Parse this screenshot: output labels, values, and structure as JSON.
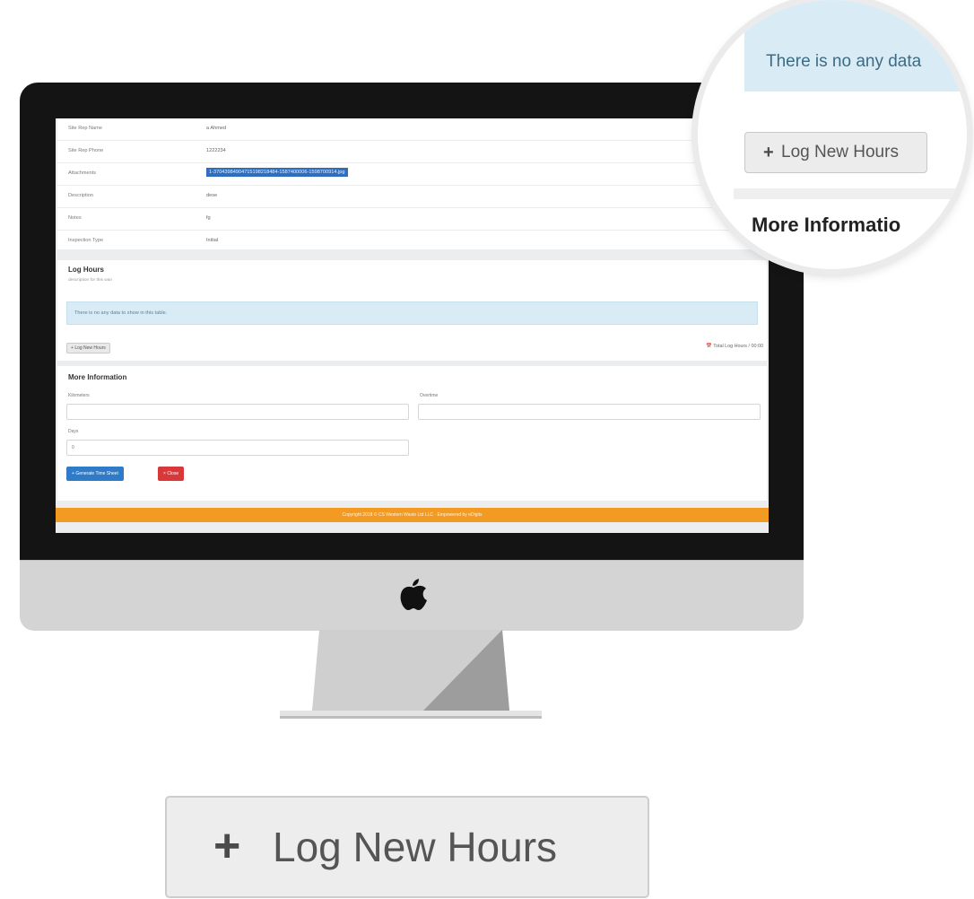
{
  "details": [
    {
      "label": "Site Rep Name",
      "value": "a Ahmed"
    },
    {
      "label": "Site Rep Phone",
      "value": "1222234"
    },
    {
      "label": "Attachments",
      "value": "1-37043984904715198218484-1587400006-1598700914.jpg"
    },
    {
      "label": "Description",
      "value": "dese"
    },
    {
      "label": "Notes",
      "value": "fg"
    },
    {
      "label": "Inspection Type",
      "value": "Initial"
    }
  ],
  "log_hours": {
    "title": "Log Hours",
    "description": "description for this wan",
    "empty_message": "There is no any data to show in this table.",
    "new_button": "Log New Hours",
    "total": "Total Log Hours / 00:00"
  },
  "more_info": {
    "title": "More Information",
    "kilometers_label": "Kilometers",
    "overtime_label": "Overtime",
    "days_label": "Days",
    "days_value": "0",
    "generate_button": "Generate Time Sheet",
    "close_button": "Close"
  },
  "footer": "Copyright 2018 © CS Western Waste Ltd LLC · Empowered by eDigits",
  "magnifier": {
    "empty_message": "There is no any data",
    "button": "Log New Hours",
    "section_title": "More Informatio"
  },
  "callout_button": "Log New Hours",
  "icons": {
    "plus": "+",
    "calendar": "📅"
  }
}
